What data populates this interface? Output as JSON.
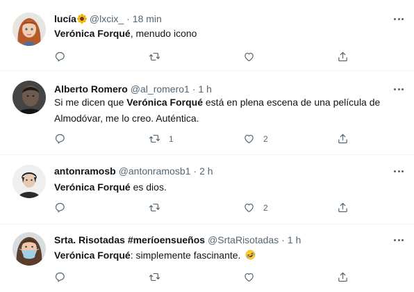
{
  "tweets": [
    {
      "name": "lucía",
      "handle": "@lxcix_",
      "time": "18 min",
      "body": [
        {
          "text": "Verónica Forqué",
          "bold": true
        },
        {
          "text": ", menudo icono",
          "bold": false
        }
      ],
      "reply_count": "",
      "retweet_count": "",
      "like_count": "",
      "avatar_icon": "red-haired-girl-avatar"
    },
    {
      "name": "Alberto Romero",
      "handle": "@al_romero1",
      "time": "1 h",
      "body": [
        {
          "text": "Si me dicen que ",
          "bold": false
        },
        {
          "text": "Verónica Forqué",
          "bold": true
        },
        {
          "text": " está en plena escena de una película de Almodóvar, me lo creo. Auténtica.",
          "bold": false
        }
      ],
      "reply_count": "",
      "retweet_count": "1",
      "like_count": "2",
      "avatar_icon": "man-portrait-avatar"
    },
    {
      "name": "antonramosb",
      "handle": "@antonramosb1",
      "time": "2 h",
      "body": [
        {
          "text": "Verónica Forqué",
          "bold": true
        },
        {
          "text": " es dios.",
          "bold": false
        }
      ],
      "reply_count": "",
      "retweet_count": "",
      "like_count": "2",
      "avatar_icon": "young-man-avatar"
    },
    {
      "name": "Srta. Risotadas #meríoensueños",
      "handle": "@SrtaRisotadas",
      "time": "1 h",
      "body": [
        {
          "text": "Verónica Forqué",
          "bold": true
        },
        {
          "text": ": simplemente fascinante. ",
          "bold": false
        }
      ],
      "reply_count": "",
      "retweet_count": "",
      "like_count": "",
      "avatar_icon": "woman-face-mask-avatar"
    }
  ],
  "separator": "·",
  "colors": {
    "text": "#0f1419",
    "secondary": "#536471",
    "divider": "#eff3f4"
  }
}
